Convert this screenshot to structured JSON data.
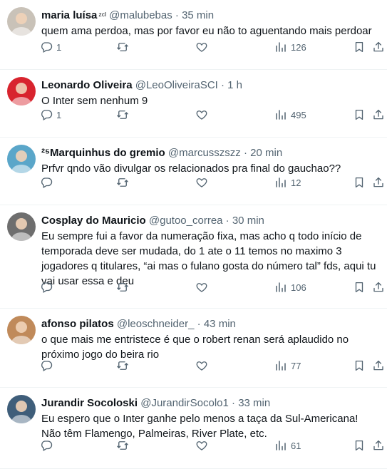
{
  "tweets": [
    {
      "name": "maria luísa",
      "name_suffix": "ᶻᶜᴵ",
      "handle": "@malubebas",
      "separator": "·",
      "time": "35 min",
      "text": "quem ama perdoa, mas por favor eu não to aguentando mais perdoar",
      "replies": "1",
      "retweets": "",
      "likes": "",
      "views": "126",
      "avatar_color": "#c9c2b8"
    },
    {
      "name": "Leonardo Oliveira",
      "name_suffix": "",
      "handle": "@LeoOliveiraSCI",
      "separator": "·",
      "time": "1 h",
      "text": "O Inter sem nenhum 9",
      "replies": "1",
      "retweets": "",
      "likes": "",
      "views": "495",
      "avatar_color": "#d8242e"
    },
    {
      "name": "²⁵Marquinhus do gremio",
      "name_suffix": "",
      "handle": "@marcusszszz",
      "separator": "·",
      "time": "20 min",
      "text": "Prfvr qndo vão divulgar os relacionados pra final do gauchao??",
      "replies": "",
      "retweets": "",
      "likes": "",
      "views": "12",
      "avatar_color": "#5aa6c9"
    },
    {
      "name": "Cosplay do Mauricio",
      "name_suffix": "",
      "handle": "@gutoo_correa",
      "separator": "·",
      "time": "30 min",
      "text": "Eu sempre fui a favor da numeração fixa, mas acho q todo início de temporada deve ser mudada, do 1 ate o 11 temos no maximo 3 jogadores q titulares, “ai mas o fulano gosta do número tal” fds, aqui tu vai usar essa e deu",
      "replies": "",
      "retweets": "",
      "likes": "",
      "views": "106",
      "avatar_color": "#6e6e6e"
    },
    {
      "name": "afonso pilatos",
      "name_suffix": "",
      "handle": "@leoschneider_",
      "separator": "·",
      "time": "43 min",
      "text": "o que mais me entristece é que o robert renan será aplaudido no próximo jogo do beira rio",
      "replies": "",
      "retweets": "",
      "likes": "",
      "views": "77",
      "avatar_color": "#c08a5a"
    },
    {
      "name": "Jurandir Socoloski",
      "name_suffix": "",
      "handle": "@JurandirSocolo1",
      "separator": "·",
      "time": "33 min",
      "text": "Eu espero que o Inter ganhe pelo menos a taça da Sul-Americana! Não têm Flamengo, Palmeiras, River Plate, etc.",
      "replies": "",
      "retweets": "",
      "likes": "",
      "views": "61",
      "avatar_color": "#3f5e7a"
    }
  ],
  "icons": {
    "reply": "reply-icon",
    "retweet": "retweet-icon",
    "like": "heart-icon",
    "views": "views-icon",
    "bookmark": "bookmark-icon",
    "share": "share-icon"
  },
  "colors": {
    "text": "#0f1419",
    "secondary": "#536471",
    "divider": "#eff3f4"
  }
}
